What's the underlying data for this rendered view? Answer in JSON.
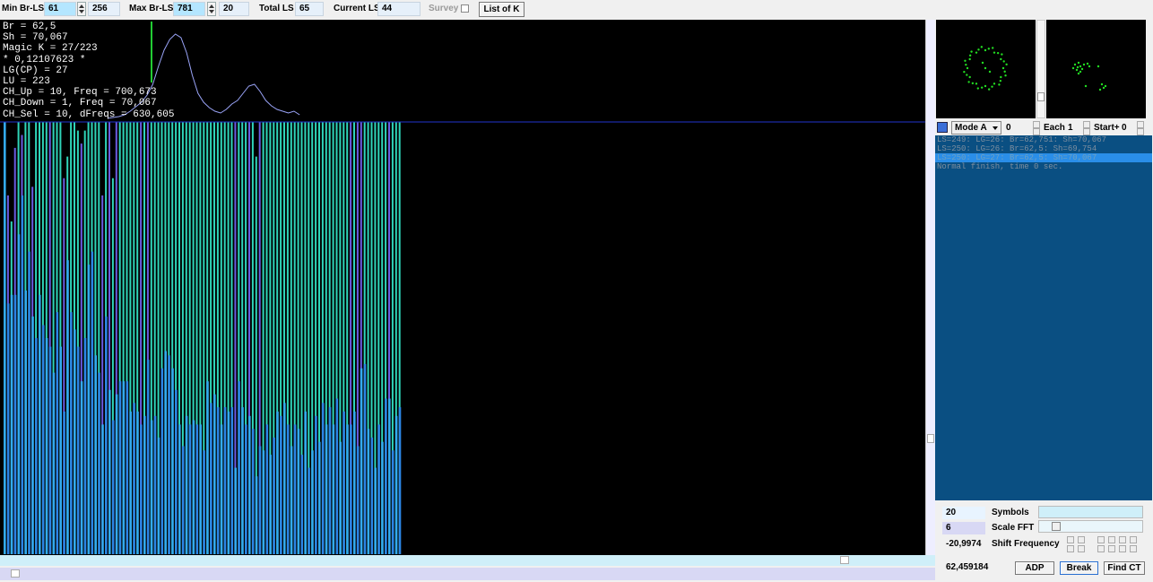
{
  "toolbar": {
    "min_br_ls_label": "Min Br-LS",
    "min_br_ls_value": "61",
    "min_br_ls_count": "256",
    "max_br_ls_label": "Max Br-LS",
    "max_br_ls_value": "781",
    "max_br_ls_count": "20",
    "total_ls_label": "Total LS",
    "total_ls_value": "65",
    "current_ls_label": "Current LS",
    "current_ls_value": "44",
    "survey_label": "Survey",
    "list_of_k_button": "List of K"
  },
  "info_overlay": [
    "Br = 62,5",
    "Sh = 70,067",
    "Magic K = 27/223",
    "* 0,12107623 *",
    "LG(CP) = 27",
    "LU = 223",
    "CH_Up = 10, Freq = 700,673",
    "CH_Down = 1, Freq = 70,067",
    "CH_Sel = 10, dFreqs = 630,605"
  ],
  "colors": {
    "plot_bg": "#000000",
    "bar_main": "#33aaee",
    "bar_stripe": "#2c84e4",
    "peak_teal": "#2fd4b8",
    "peak_violet": "#6a5be0",
    "left_red": "#e81010",
    "curve": "#9aa4f8",
    "marker": "#22cc33",
    "baseline": "#2233cc",
    "log_bg": "#0a4f82",
    "log_selected": "#2a8ee8",
    "dots": "#22dd22"
  },
  "chart_data": {
    "type": "bar",
    "ylim": [
      0,
      100
    ],
    "values": [
      {
        "h": 100,
        "p": 100,
        "c": "red"
      },
      {
        "h": 58,
        "p": 83,
        "c": "violet"
      },
      {
        "h": 60,
        "p": 77,
        "c": "teal"
      },
      {
        "h": 60,
        "p": 94,
        "c": "violet"
      },
      {
        "h": 74,
        "p": 100,
        "c": "teal"
      },
      {
        "h": 83,
        "p": 97,
        "c": "violet"
      },
      {
        "h": 61,
        "p": 100,
        "c": "teal"
      },
      {
        "h": 70,
        "p": 100,
        "c": "teal"
      },
      {
        "h": 55,
        "p": 85,
        "c": "violet"
      },
      {
        "h": 50,
        "p": 100,
        "c": "teal"
      },
      {
        "h": 60,
        "p": 100,
        "c": "teal"
      },
      {
        "h": 53,
        "p": 100,
        "c": "teal"
      },
      {
        "h": 50,
        "p": 100,
        "c": "teal"
      },
      {
        "h": 48,
        "p": 100,
        "c": "violet"
      },
      {
        "h": 42,
        "p": 100,
        "c": "teal"
      },
      {
        "h": 56,
        "p": 100,
        "c": "teal"
      },
      {
        "h": 48,
        "p": 100,
        "c": "teal"
      },
      {
        "h": 33,
        "p": 87,
        "c": "violet"
      },
      {
        "h": 68,
        "p": 92,
        "c": "teal"
      },
      {
        "h": 56,
        "p": 100,
        "c": "teal"
      },
      {
        "h": 52,
        "p": 100,
        "c": "teal"
      },
      {
        "h": 48,
        "p": 98,
        "c": "teal"
      },
      {
        "h": 40,
        "p": 95,
        "c": "violet"
      },
      {
        "h": 50,
        "p": 98,
        "c": "teal"
      },
      {
        "h": 67,
        "p": 100,
        "c": "teal"
      },
      {
        "h": 70,
        "p": 100,
        "c": "teal"
      },
      {
        "h": 46,
        "p": 100,
        "c": "teal"
      },
      {
        "h": 42,
        "p": 100,
        "c": "teal"
      },
      {
        "h": 30,
        "p": 83,
        "c": "violet"
      },
      {
        "h": 55,
        "p": 100,
        "c": "teal"
      },
      {
        "h": 38,
        "p": 100,
        "c": "violet"
      },
      {
        "h": 31,
        "p": 87,
        "c": "teal"
      },
      {
        "h": 37,
        "p": 100,
        "c": "violet"
      },
      {
        "h": 40,
        "p": 100,
        "c": "teal"
      },
      {
        "h": 40,
        "p": 100,
        "c": "teal"
      },
      {
        "h": 40,
        "p": 100,
        "c": "teal"
      },
      {
        "h": 33,
        "p": 100,
        "c": "teal"
      },
      {
        "h": 35,
        "p": 100,
        "c": "teal"
      },
      {
        "h": 33,
        "p": 100,
        "c": "teal"
      },
      {
        "h": 30,
        "p": 100,
        "c": "violet"
      },
      {
        "h": 32,
        "p": 100,
        "c": "teal"
      },
      {
        "h": 45,
        "p": 100,
        "c": "violet"
      },
      {
        "h": 31,
        "p": 100,
        "c": "teal"
      },
      {
        "h": 32,
        "p": 100,
        "c": "teal"
      },
      {
        "h": 27,
        "p": 100,
        "c": "teal"
      },
      {
        "h": 43,
        "p": 100,
        "c": "teal"
      },
      {
        "h": 47,
        "p": 100,
        "c": "teal"
      },
      {
        "h": 46,
        "p": 100,
        "c": "teal"
      },
      {
        "h": 43,
        "p": 100,
        "c": "teal"
      },
      {
        "h": 38,
        "p": 100,
        "c": "teal"
      },
      {
        "h": 30,
        "p": 100,
        "c": "teal"
      },
      {
        "h": 25,
        "p": 100,
        "c": "teal"
      },
      {
        "h": 32,
        "p": 100,
        "c": "teal"
      },
      {
        "h": 30,
        "p": 100,
        "c": "teal"
      },
      {
        "h": 31,
        "p": 100,
        "c": "teal"
      },
      {
        "h": 30,
        "p": 100,
        "c": "teal"
      },
      {
        "h": 30,
        "p": 100,
        "c": "teal"
      },
      {
        "h": 24,
        "p": 100,
        "c": "teal"
      },
      {
        "h": 40,
        "p": 100,
        "c": "teal"
      },
      {
        "h": 35,
        "p": 100,
        "c": "teal"
      },
      {
        "h": 37,
        "p": 100,
        "c": "teal"
      },
      {
        "h": 34,
        "p": 100,
        "c": "teal"
      },
      {
        "h": 30,
        "p": 100,
        "c": "teal"
      },
      {
        "h": 34,
        "p": 100,
        "c": "teal"
      },
      {
        "h": 33,
        "p": 100,
        "c": "teal"
      },
      {
        "h": 34,
        "p": 100,
        "c": "teal"
      },
      {
        "h": 20,
        "p": 100,
        "c": "violet"
      },
      {
        "h": 40,
        "p": 100,
        "c": "teal"
      },
      {
        "h": 34,
        "p": 100,
        "c": "teal"
      },
      {
        "h": 30,
        "p": 100,
        "c": "teal"
      },
      {
        "h": 32,
        "p": 100,
        "c": "violet"
      },
      {
        "h": 29,
        "p": 100,
        "c": "teal"
      },
      {
        "h": 18,
        "p": 92,
        "c": "teal"
      },
      {
        "h": 25,
        "p": 100,
        "c": "violet"
      },
      {
        "h": 24,
        "p": 100,
        "c": "teal"
      },
      {
        "h": 30,
        "p": 100,
        "c": "teal"
      },
      {
        "h": 23,
        "p": 100,
        "c": "teal"
      },
      {
        "h": 27,
        "p": 100,
        "c": "teal"
      },
      {
        "h": 33,
        "p": 100,
        "c": "teal"
      },
      {
        "h": 32,
        "p": 100,
        "c": "teal"
      },
      {
        "h": 35,
        "p": 100,
        "c": "teal"
      },
      {
        "h": 30,
        "p": 100,
        "c": "teal"
      },
      {
        "h": 25,
        "p": 100,
        "c": "teal"
      },
      {
        "h": 30,
        "p": 100,
        "c": "teal"
      },
      {
        "h": 29,
        "p": 100,
        "c": "teal"
      },
      {
        "h": 23,
        "p": 100,
        "c": "teal"
      },
      {
        "h": 33,
        "p": 100,
        "c": "teal"
      },
      {
        "h": 20,
        "p": 100,
        "c": "teal"
      },
      {
        "h": 24,
        "p": 100,
        "c": "teal"
      },
      {
        "h": 32,
        "p": 100,
        "c": "teal"
      },
      {
        "h": 26,
        "p": 100,
        "c": "teal"
      },
      {
        "h": 35,
        "p": 100,
        "c": "teal"
      },
      {
        "h": 30,
        "p": 100,
        "c": "teal"
      },
      {
        "h": 34,
        "p": 100,
        "c": "teal"
      },
      {
        "h": 30,
        "p": 100,
        "c": "teal"
      },
      {
        "h": 36,
        "p": 100,
        "c": "teal"
      },
      {
        "h": 26,
        "p": 100,
        "c": "teal"
      },
      {
        "h": 33,
        "p": 100,
        "c": "teal"
      },
      {
        "h": 30,
        "p": 100,
        "c": "teal"
      },
      {
        "h": 30,
        "p": 100,
        "c": "violet"
      },
      {
        "h": 33,
        "p": 100,
        "c": "teal"
      },
      {
        "h": 25,
        "p": 100,
        "c": "violet"
      },
      {
        "h": 43,
        "p": 100,
        "c": "violet"
      },
      {
        "h": 44,
        "p": 100,
        "c": "teal"
      },
      {
        "h": 29,
        "p": 100,
        "c": "teal"
      },
      {
        "h": 27,
        "p": 100,
        "c": "teal"
      },
      {
        "h": 20,
        "p": 100,
        "c": "teal"
      },
      {
        "h": 30,
        "p": 100,
        "c": "teal"
      },
      {
        "h": 26,
        "p": 100,
        "c": "teal"
      },
      {
        "h": 36,
        "p": 100,
        "c": "teal"
      },
      {
        "h": 36,
        "p": 100,
        "c": "violet"
      },
      {
        "h": 24,
        "p": 100,
        "c": "teal"
      },
      {
        "h": 32,
        "p": 100,
        "c": "teal"
      },
      {
        "h": 34,
        "p": 100,
        "c": "teal"
      }
    ]
  },
  "overlay_chart": {
    "marker_index": 42,
    "curve": [
      2,
      3,
      4,
      6,
      10,
      15,
      20,
      28,
      40,
      60,
      78,
      90,
      96,
      92,
      75,
      50,
      30,
      20,
      14,
      10,
      8,
      12,
      18,
      22,
      30,
      38,
      40,
      32,
      22,
      16,
      12,
      10,
      8,
      10,
      6
    ]
  },
  "right_panel": {
    "mode_select": "Mode A",
    "mode_value": "0",
    "each_label": "Each",
    "each_value": "1",
    "start_label": "Start+",
    "start_value": "0",
    "log_lines": [
      {
        "text": "LS=249: LG=26: Br=62,751: Sh=70,067",
        "selected": false
      },
      {
        "text": "LS=250: LG=26: Br=62,5: Sh=69,754",
        "selected": false
      },
      {
        "text": "LS=250: LG=27: Br=62,5: Sh=70,067",
        "selected": true
      },
      {
        "text": "Normal finish, time 0 sec.",
        "selected": false
      }
    ],
    "symbols_value": "20",
    "symbols_label": "Symbols",
    "scale_fft_value": "6",
    "scale_fft_label": "Scale FFT",
    "shift_value": "-20,9974",
    "shift_label": "Shift Frequency",
    "bottom_value": "62,459184",
    "adp_button": "ADP",
    "break_button": "Break",
    "find_ct_button": "Find CT"
  }
}
